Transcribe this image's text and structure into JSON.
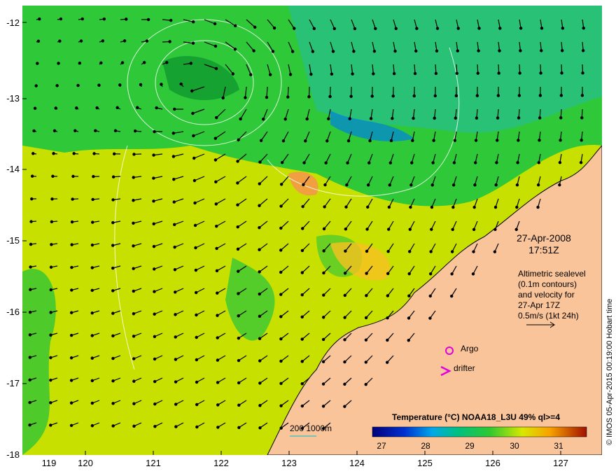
{
  "map": {
    "lat_labels": [
      "-12",
      "-13",
      "-14",
      "-15",
      "-16",
      "-17",
      "-18"
    ],
    "lon_labels": [
      "119",
      "120",
      "121",
      "122",
      "123",
      "124",
      "125",
      "126",
      "127"
    ],
    "date": "27-Apr-2008",
    "time": "17:51Z",
    "altimetry_lines": [
      "Altimetric sealevel",
      "(0.1m contours)",
      "and velocity for",
      "27-Apr 17Z",
      "0.5m/s (1kt 24h)"
    ],
    "argo_label": "Argo",
    "drifter_label": "drifter",
    "bathy_label": "200  1000m",
    "colorbar_title": "Temperature (°C) NOAA18_L3U 49% ql>=4",
    "colorbar_ticks": [
      "27",
      "28",
      "29",
      "30",
      "31"
    ],
    "credit": "© IMOS 05-Apr-2015 00:19:00 Hobart time",
    "colors": {
      "land": "#f9c49a",
      "sst_warm": "#d2e800",
      "sst_mid": "#2fc832",
      "sst_cool": "#00b8b0",
      "argo": "#e000e0",
      "drifter": "#e000e0"
    }
  }
}
